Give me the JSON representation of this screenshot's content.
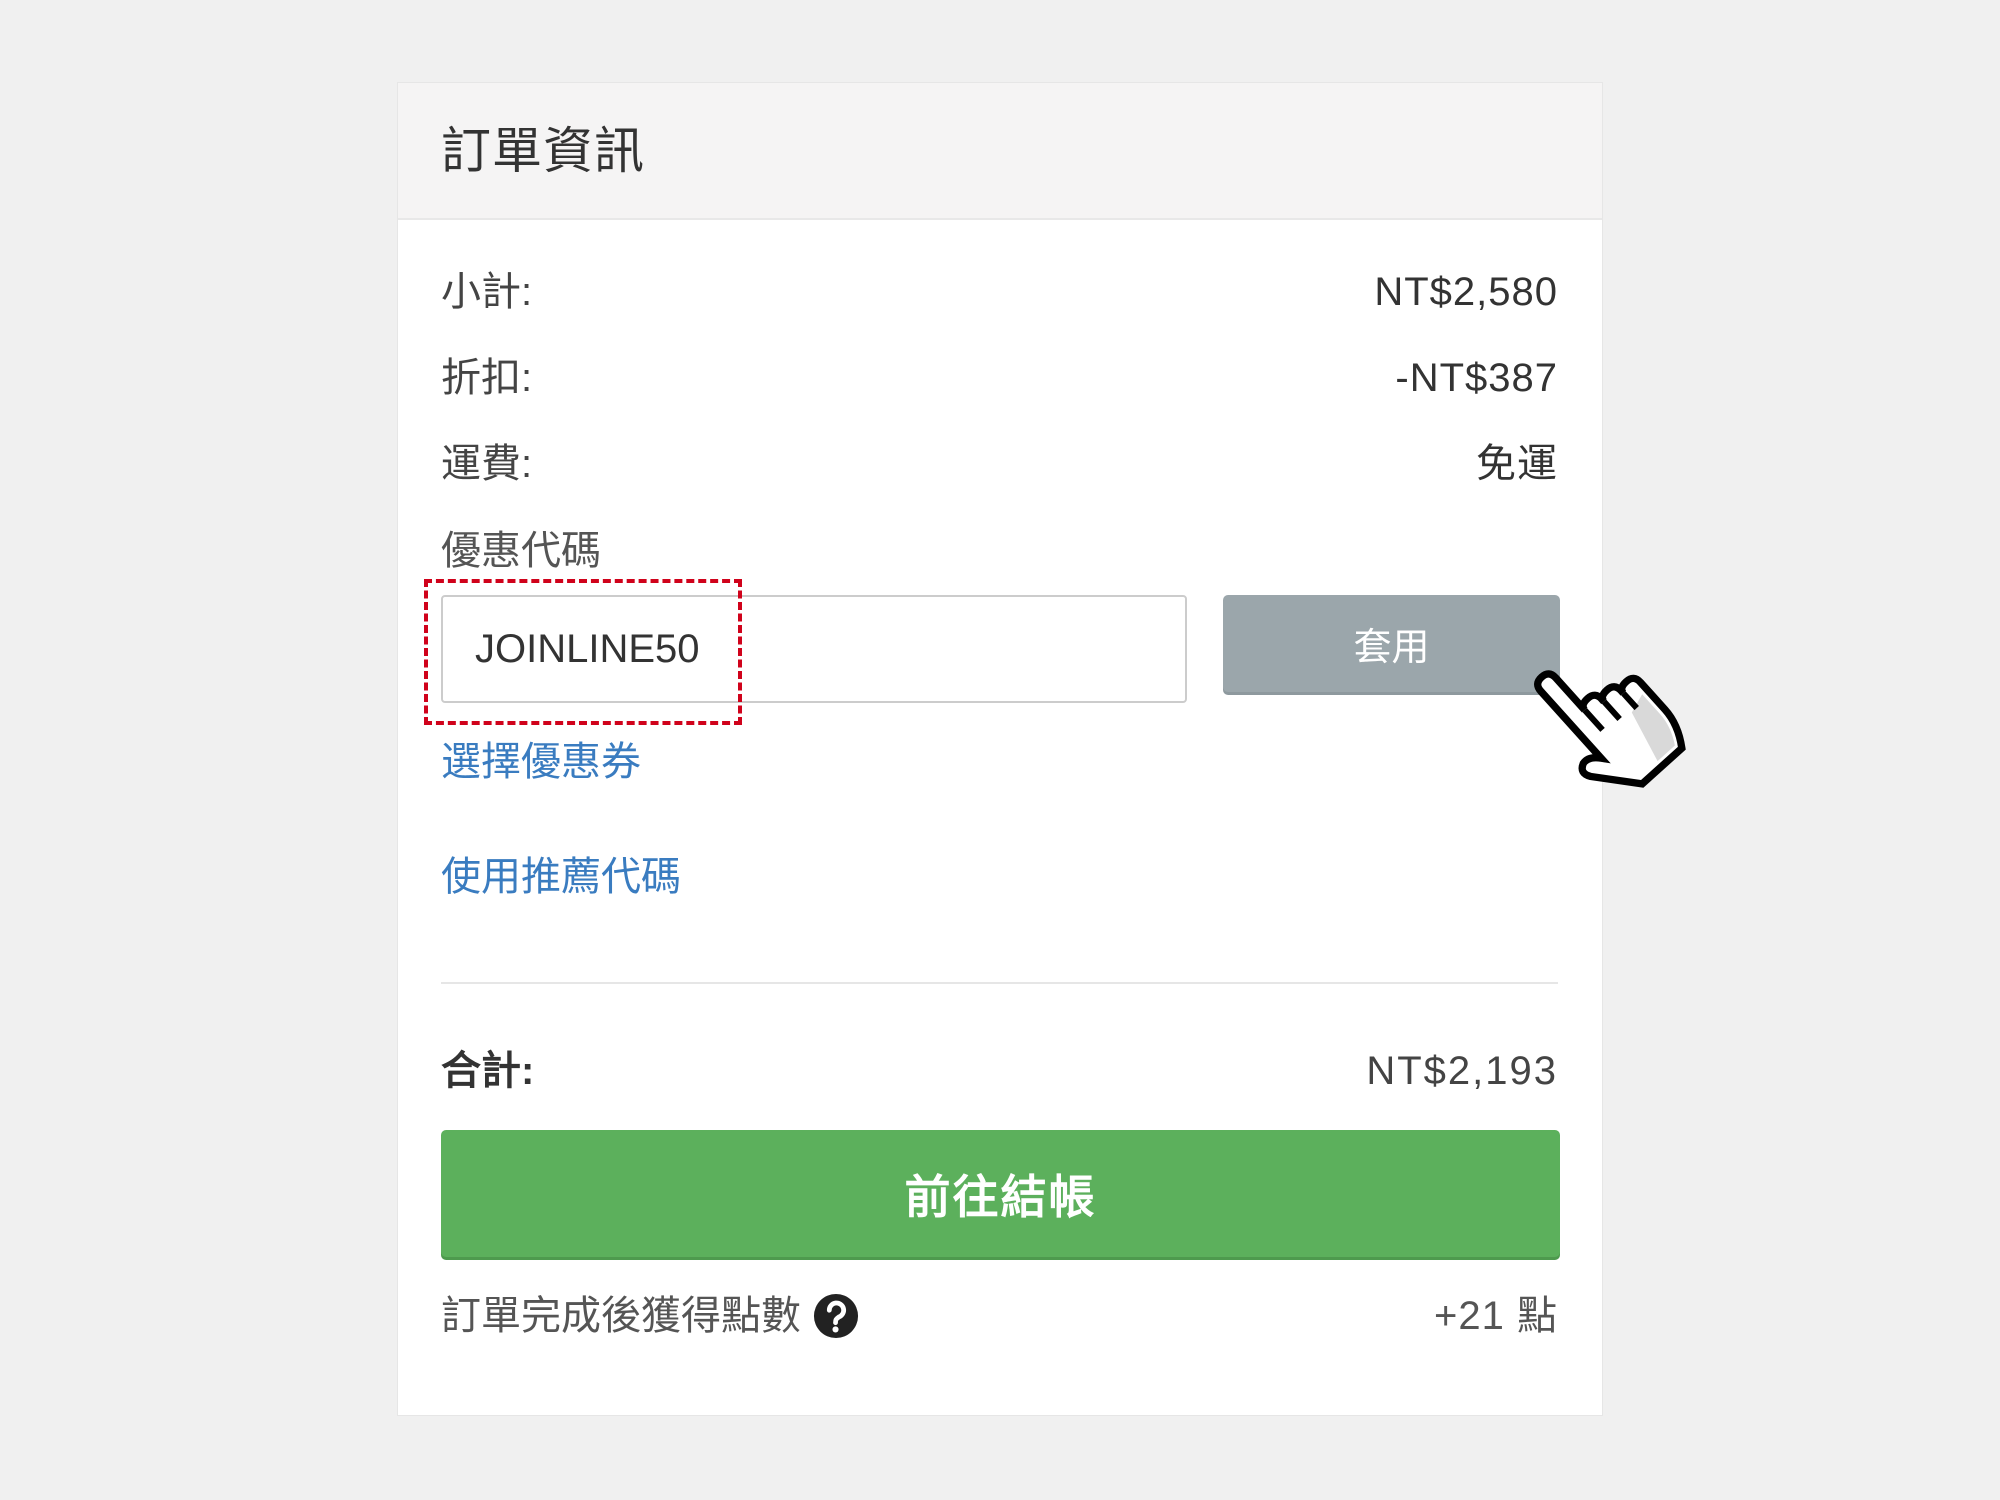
{
  "header": {
    "title": "訂單資訊"
  },
  "summary": {
    "subtotal": {
      "label": "小計:",
      "value": "NT$2,580"
    },
    "discount": {
      "label": "折扣:",
      "value": "-NT$387"
    },
    "shipping": {
      "label": "運費:",
      "value": "免運"
    }
  },
  "coupon": {
    "label": "優惠代碼",
    "input_value": "JOINLINE50",
    "apply_label": "套用",
    "select_coupon_link": "選擇優惠券",
    "referral_link": "使用推薦代碼"
  },
  "total": {
    "label": "合計:",
    "value": "NT$2,193"
  },
  "checkout": {
    "label": "前往結帳"
  },
  "points": {
    "label": "訂單完成後獲得點數",
    "value": "+21 點"
  },
  "icons": {
    "help": "question-circle-icon",
    "cursor": "hand-pointer-icon"
  },
  "colors": {
    "page_bg": "#f0f0f0",
    "checkout_bg": "#5cb05c",
    "apply_bg": "#9ba6ab",
    "link": "#3a7cc0",
    "highlight": "#d0021b"
  }
}
